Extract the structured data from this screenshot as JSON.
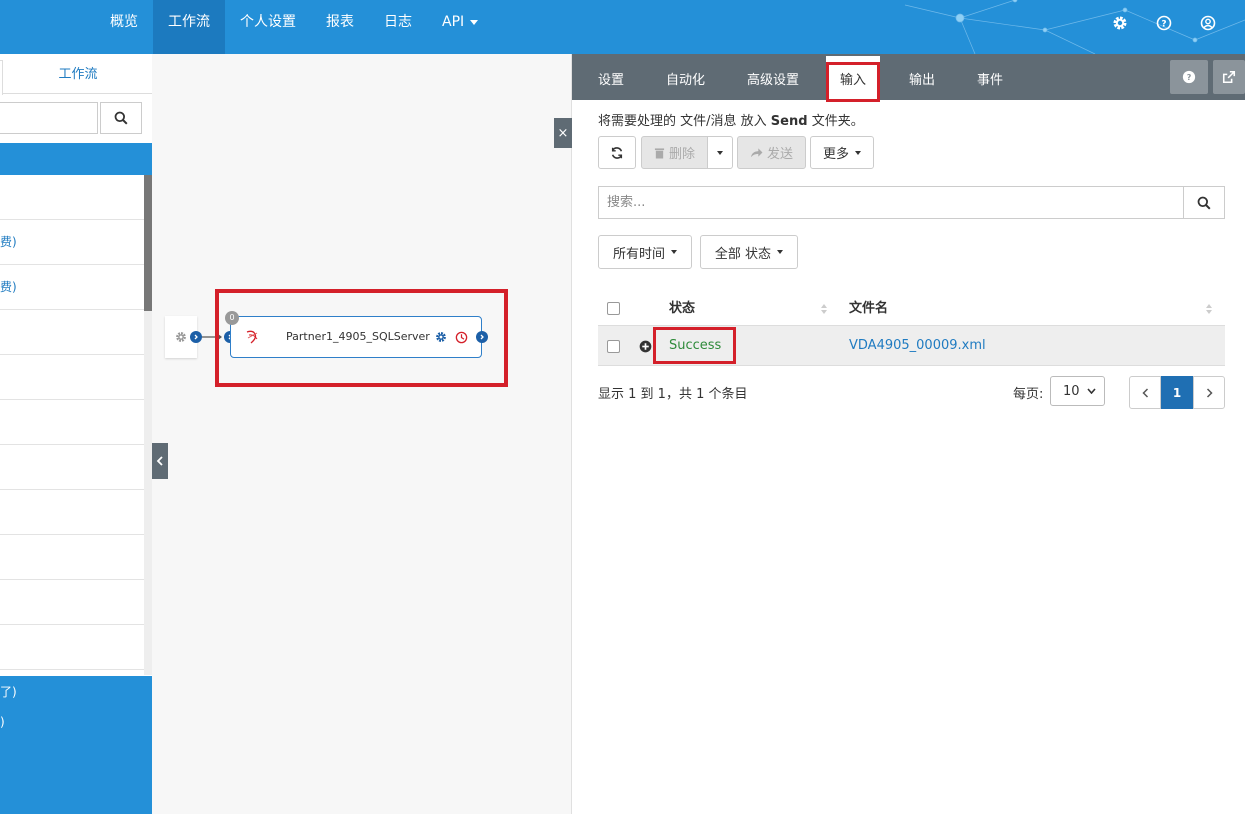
{
  "nav": {
    "items": [
      "概览",
      "工作流",
      "个人设置",
      "报表",
      "日志",
      "API"
    ],
    "active_index": 1
  },
  "icons": {
    "top": [
      "gear-icon",
      "help-circle-icon",
      "user-circle-icon"
    ]
  },
  "left_panel": {
    "tab_label": "工作流",
    "list_items": [
      "",
      "费)",
      "费)",
      "",
      "",
      "",
      "",
      "",
      "",
      "",
      ""
    ],
    "bottom_items": [
      "了)",
      ")"
    ]
  },
  "canvas": {
    "node_label": "Partner1_4905_SQLServer",
    "node_badge": "0"
  },
  "right_panel": {
    "tabs": [
      "设置",
      "自动化",
      "高级设置",
      "输入",
      "输出",
      "事件"
    ],
    "active_tab": "输入",
    "info_prefix": "将需要处理的 文件/消息 放入",
    "info_bold": "Send",
    "info_suffix": "文件夹。",
    "toolbar": {
      "delete_label": "删除",
      "send_label": "发送",
      "more_label": "更多"
    },
    "search_placeholder": "搜索...",
    "filters": {
      "time_label": "所有时间",
      "status_label": "全部 状态"
    },
    "table": {
      "columns": [
        "状态",
        "文件名"
      ],
      "rows": [
        {
          "status": "Success",
          "filename": "VDA4905_00009.xml"
        }
      ]
    },
    "pagination": {
      "info": "显示 1 到 1，共 1 个条目",
      "per_page_label": "每页:",
      "per_page_value": "10",
      "current_page": "1"
    }
  },
  "colors": {
    "nav_bg": "#2490d8",
    "accent": "#1f7bc1",
    "highlight_red": "#d4202a",
    "success_green": "#2e8b3a"
  }
}
